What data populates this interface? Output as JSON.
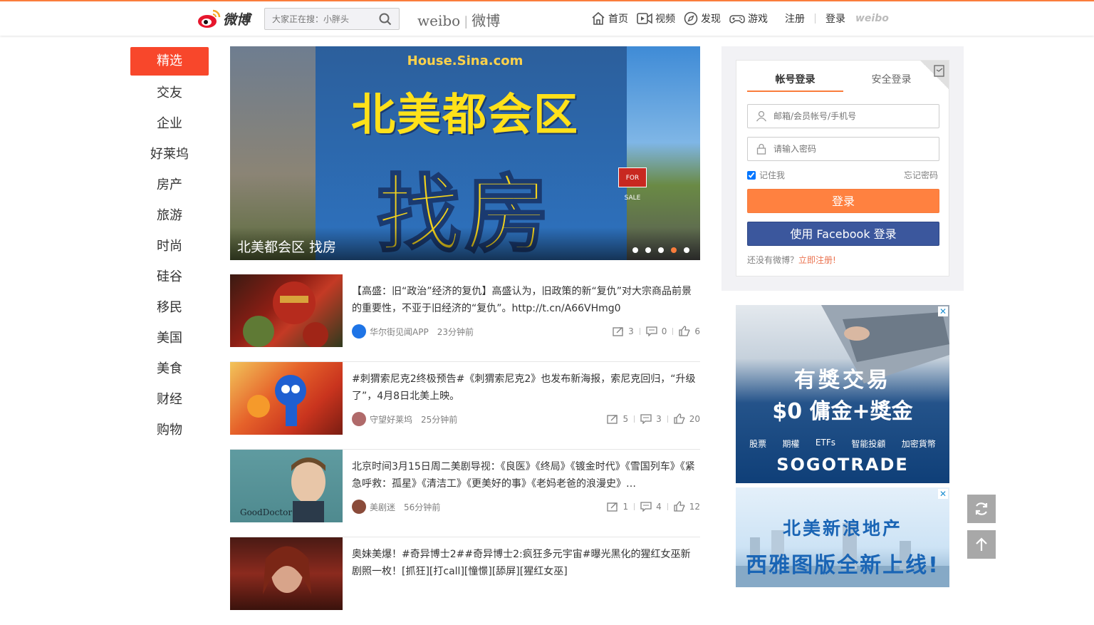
{
  "header": {
    "logo_text": "微博",
    "search": {
      "placeholder": "大家正在搜：小胖头"
    },
    "brand_en": "weibo",
    "brand_cn": "微博",
    "nav": [
      {
        "label": "首页",
        "icon": "home-icon"
      },
      {
        "label": "视频",
        "icon": "video-icon"
      },
      {
        "label": "发现",
        "icon": "discover-icon"
      },
      {
        "label": "游戏",
        "icon": "game-icon"
      }
    ],
    "register": "注册",
    "login": "登录",
    "weibo_mark": "weibo"
  },
  "sidebar": {
    "items": [
      {
        "label": "精选",
        "active": true
      },
      {
        "label": "交友"
      },
      {
        "label": "企业"
      },
      {
        "label": "好莱坞"
      },
      {
        "label": "房产"
      },
      {
        "label": "旅游"
      },
      {
        "label": "时尚"
      },
      {
        "label": "硅谷"
      },
      {
        "label": "移民"
      },
      {
        "label": "美国"
      },
      {
        "label": "美食"
      },
      {
        "label": "财经"
      },
      {
        "label": "购物"
      }
    ]
  },
  "banner": {
    "site": "House.Sina.com",
    "headline": "北美都会区",
    "headline2": "找房",
    "sign": "FOR SALE",
    "caption": "北美都会区 找房",
    "dots": 5,
    "active_dot": 4
  },
  "feed": [
    {
      "text": "【高盛：旧“政治”经济的复仇】高盛认为，旧政策的新“复仇”对大宗商品前景的重要性，不亚于旧经济的“复仇”。http://t.cn/A66VHmg0",
      "author": "华尔街见闻APP",
      "time": "23分钟前",
      "reposts": "3",
      "comments": "0",
      "likes": "6",
      "avatar_color": "#1e74e6"
    },
    {
      "text": "#刺猬索尼克2终极预告#《刺猬索尼克2》也发布新海报，索尼克回归，“升级了”，4月8日北美上映。",
      "author": "守望好莱坞",
      "time": "25分钟前",
      "reposts": "5",
      "comments": "3",
      "likes": "20",
      "avatar_color": "#b06a6a"
    },
    {
      "text": "北京时间3月15日周二美剧导视：《良医》《终局》《镀金时代》《雪国列车》《紧急呼救：孤星》《清洁工》《更美好的事》《老妈老爸的浪漫史》…",
      "author": "美剧迷",
      "time": "56分钟前",
      "reposts": "1",
      "comments": "4",
      "likes": "12",
      "avatar_color": "#8a4b3a",
      "thumb_text": "GoodDoctor"
    },
    {
      "text": "奥妹美爆！#奇异博士2##奇异博士2:疯狂多元宇宙#曝光黑化的猩红女巫新剧照一枚！[抓狂][打call][憧憬][舔屏][猩红女巫]",
      "author": "",
      "time": "",
      "reposts": "",
      "comments": "",
      "likes": "",
      "avatar_color": "#555"
    }
  ],
  "login": {
    "tab_account": "帐号登录",
    "tab_secure": "安全登录",
    "user_placeholder": "邮箱/会员帐号/手机号",
    "pass_placeholder": "请输入密码",
    "remember": "记住我",
    "forget": "忘记密码",
    "login_btn": "登录",
    "fb_btn": "使用 Facebook 登录",
    "no_account": "还没有微博？",
    "register_now": "立即注册!"
  },
  "ads": {
    "ad1": {
      "line1": "有獎交易",
      "line2": "$0 傭金+獎金",
      "row": [
        "股票",
        "期權",
        "ETFs",
        "智能投顧",
        "加密貨幣"
      ],
      "brand": "SOGOTRADE"
    },
    "ad2": {
      "line1": "北美新浪地产",
      "line2": "西雅图版全新上线!"
    },
    "close": "✕"
  },
  "colors": {
    "accent": "#fa7d3c",
    "active_red": "#f8472b",
    "facebook": "#3b579d"
  }
}
